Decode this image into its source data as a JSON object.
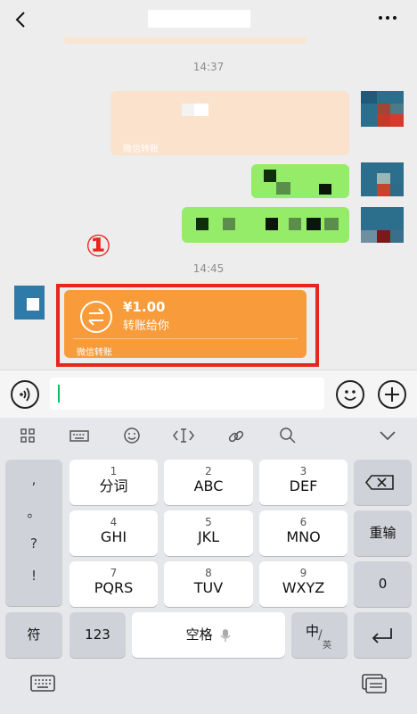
{
  "header": {
    "back_icon": "chevron-left-icon",
    "more_icon": "ellipsis-icon"
  },
  "chat": {
    "timestamp_1": "14:37",
    "transfer_sent_label": "微信转账",
    "timestamp_2": "14:45",
    "annotation_marker": "①",
    "transfer_received": {
      "amount": "¥1.00",
      "message": "转账给你",
      "footer": "微信转账",
      "icon": "transfer-arrows-icon",
      "accent": "#f89c3b"
    },
    "highlight_color": "#e8251f"
  },
  "composer": {
    "voice_icon": "voice-icon",
    "emoji_icon": "emoji-icon",
    "add_icon": "plus-icon"
  },
  "keyboard": {
    "toolbar": [
      "grid-icon",
      "keyboard-icon",
      "smiley-icon",
      "cursor-icon",
      "link-icon",
      "search-icon",
      "chevron-down-icon"
    ],
    "symbols": [
      ",",
      "。",
      "?",
      "!"
    ],
    "rows": [
      [
        {
          "num": "1",
          "label": "分词"
        },
        {
          "num": "2",
          "label": "ABC"
        },
        {
          "num": "3",
          "label": "DEF"
        }
      ],
      [
        {
          "num": "4",
          "label": "GHI"
        },
        {
          "num": "5",
          "label": "JKL"
        },
        {
          "num": "6",
          "label": "MNO"
        }
      ],
      [
        {
          "num": "7",
          "label": "PQRS"
        },
        {
          "num": "8",
          "label": "TUV"
        },
        {
          "num": "9",
          "label": "WXYZ"
        }
      ]
    ],
    "reenter": "重输",
    "zero": "0",
    "fu": "符",
    "num_switch": "123",
    "space": "空格",
    "zh": "中",
    "en": "英"
  }
}
